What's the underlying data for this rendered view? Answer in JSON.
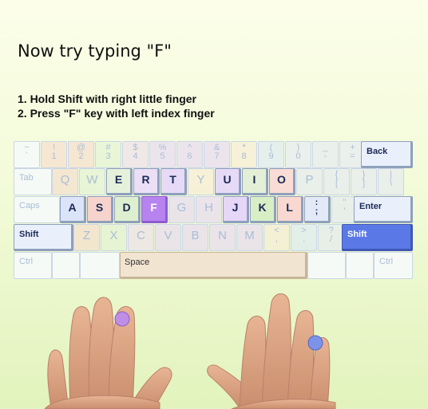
{
  "title": "Now try typing \"F\"",
  "instructions": [
    "1. Hold Shift with right little finger",
    "2. Press \"F\" key with left index finger"
  ],
  "keyboard": {
    "row1": [
      {
        "top": "~",
        "bot": "`"
      },
      {
        "top": "!",
        "bot": "1"
      },
      {
        "top": "@",
        "bot": "2"
      },
      {
        "top": "#",
        "bot": "3"
      },
      {
        "top": "$",
        "bot": "4"
      },
      {
        "top": "%",
        "bot": "5"
      },
      {
        "top": "^",
        "bot": "6"
      },
      {
        "top": "&",
        "bot": "7"
      },
      {
        "top": "*",
        "bot": "8"
      },
      {
        "top": "(",
        "bot": "9"
      },
      {
        "top": ")",
        "bot": "0"
      },
      {
        "top": "_",
        "bot": "-"
      },
      {
        "top": "+",
        "bot": "="
      }
    ],
    "row2": [
      "Q",
      "W",
      "E",
      "R",
      "T",
      "Y",
      "U",
      "I",
      "O",
      "P",
      {
        "top": "{",
        "bot": "["
      },
      {
        "top": "}",
        "bot": "]"
      },
      {
        "top": "|",
        "bot": "\\"
      }
    ],
    "row3": [
      "A",
      "S",
      "D",
      "F",
      "G",
      "H",
      "J",
      "K",
      "L",
      {
        "top": ":",
        "bot": ";"
      },
      {
        "top": "\"",
        "bot": "'"
      }
    ],
    "row4": [
      "Z",
      "X",
      "C",
      "V",
      "B",
      "N",
      "M",
      {
        "top": "<",
        "bot": ","
      },
      {
        "top": ">",
        "bot": "."
      },
      {
        "top": "?",
        "bot": "/"
      }
    ],
    "back": "Back",
    "tab": "Tab",
    "caps": "Caps",
    "enter": "Enter",
    "shift_left": "Shift",
    "shift_right": "Shift",
    "ctrl_left": "Ctrl",
    "ctrl_right": "Ctrl",
    "space": "Space",
    "target_key": "F",
    "highlighted_key": "Shift (right)"
  },
  "colors": {
    "target_key": "#b784ef",
    "shift_highlight": "#5b79e6",
    "left_pinky": "#f7cfc8",
    "left_ring": "#dff1d3",
    "left_middle": "#ecdcee",
    "index_fingers": "#e6d6f7",
    "right_middle": "#f7ecd6",
    "right_ring": "#dbe7f8",
    "right_pinky": "#e3e8f5",
    "finger_marker_left_index": "#c08ee6",
    "finger_marker_right_pinky": "#7d93e9"
  }
}
